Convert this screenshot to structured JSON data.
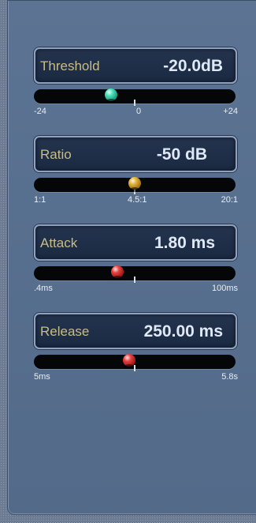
{
  "controls": [
    {
      "label": "Threshold",
      "value": "-20.0dB",
      "knob_color": "green",
      "level": 0.375,
      "scale": [
        "-24",
        "0",
        "+24"
      ]
    },
    {
      "label": "Ratio",
      "value": "-50 dB",
      "knob_color": "yellow",
      "level": 0.5,
      "scale": [
        "1:1",
        "4.5:1",
        "20:1"
      ]
    },
    {
      "label": "Attack",
      "value": "1.80 ms",
      "knob_color": "red",
      "level": 0.41,
      "scale": [
        ".4ms",
        "",
        "100ms"
      ]
    },
    {
      "label": "Release",
      "value": "250.00 ms",
      "knob_color": "red",
      "level": 0.47,
      "scale": [
        "5ms",
        "",
        "5.8s"
      ]
    }
  ]
}
